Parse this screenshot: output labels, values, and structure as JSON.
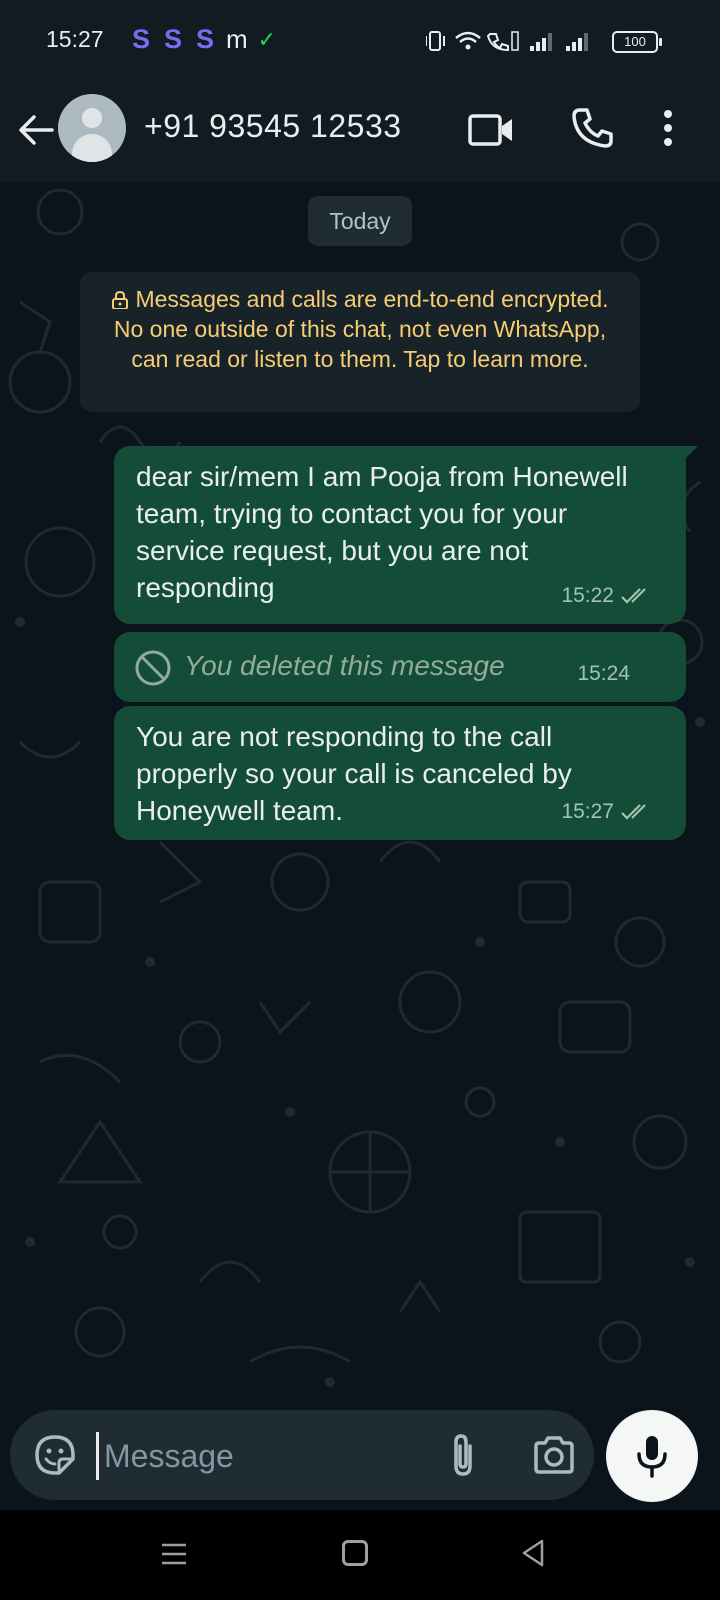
{
  "status_bar": {
    "time": "15:27",
    "app_icons": [
      "S",
      "S",
      "S",
      "m"
    ],
    "battery": "100"
  },
  "header": {
    "contact_name": "+91 93545 12533",
    "icons": [
      "back-arrow-icon",
      "video-call-icon",
      "voice-call-icon",
      "more-options-icon"
    ]
  },
  "chat": {
    "date_chip": "Today",
    "encryption_notice": "Messages and calls are end-to-end encrypted. No one outside of this chat, not even WhatsApp, can read or listen to them. Tap to learn more.",
    "messages": [
      {
        "text": "dear sir/mem I am Pooja from Honewell team, trying to contact you for your service request, but you are not responding",
        "time": "15:22",
        "status": "read"
      },
      {
        "text": "You deleted this message",
        "time": "15:24",
        "deleted": true
      },
      {
        "text": "You are not responding to the call properly so your call is canceled by Honeywell team.",
        "time": "15:27",
        "status": "read"
      }
    ]
  },
  "composer": {
    "placeholder": "Message"
  },
  "colors": {
    "outgoing_bubble": "#144d37",
    "background": "#0b141a",
    "header": "#121b22",
    "notice_text": "#f7cd73"
  }
}
